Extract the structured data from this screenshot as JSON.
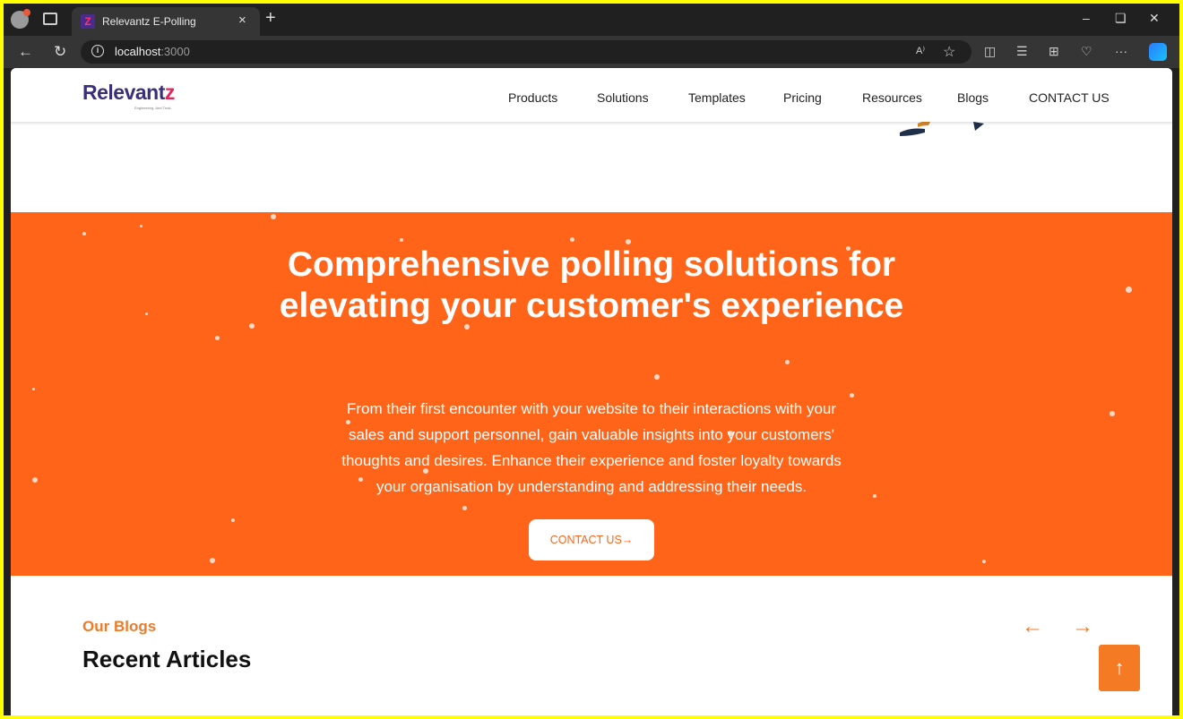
{
  "browser": {
    "tab_title": "Relevantz E-Polling",
    "tab_favicon": "Z",
    "close_tab": "×",
    "new_tab": "+",
    "url_host": "localhost",
    "url_port": ":3000",
    "read_aloud": "A⁾",
    "more": "···"
  },
  "navbar": {
    "logo_main": "Relevant",
    "logo_z": "z",
    "logo_tagline": "Engineering. And Trust.",
    "links": [
      "Products",
      "Solutions",
      "Templates",
      "Pricing",
      "Resources",
      "Blogs",
      "CONTACT US"
    ]
  },
  "hero": {
    "title": "Comprehensive polling solutions for elevating your customer's experience",
    "text": "From their first encounter with your website to their interactions with your sales and support personnel, gain valuable insights into your customers' thoughts and desires. Enhance their experience and foster loyalty towards your organisation by understanding and addressing their needs.",
    "cta_label": "CONTACT US→"
  },
  "blogs": {
    "eyebrow": "Our Blogs",
    "title": "Recent Articles",
    "prev": "←",
    "next": "→"
  },
  "scroll_top": "↑",
  "colors": {
    "accent": "#ff6418",
    "brand": "#3a2f7a",
    "highlight": "#e6245a"
  },
  "icons": [
    "profile-icon",
    "tabs-icon",
    "back-icon",
    "refresh-icon",
    "info-icon",
    "read-aloud-icon",
    "favorite-icon",
    "split-screen-icon",
    "favorites-list-icon",
    "collections-icon",
    "health-icon",
    "more-icon",
    "copilot-icon"
  ]
}
